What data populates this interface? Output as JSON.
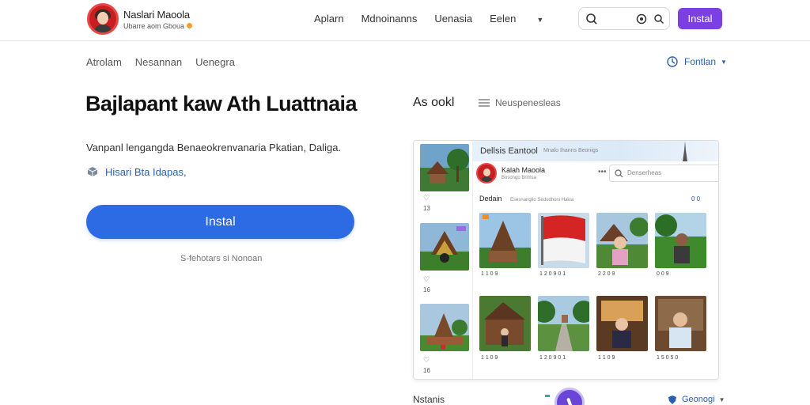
{
  "header": {
    "brand_title": "Naslari Maoola",
    "brand_sub": "Ubarre aom Gboua",
    "nav": [
      "Aplarn",
      "Mdnoinanns",
      "Uenasia",
      "Eelen"
    ],
    "search_placeholder": "",
    "install_label": "Instal",
    "accent": "#7b3fe4"
  },
  "subnav": {
    "items": [
      "Atrolam",
      "Nesannan",
      "Uenegra"
    ],
    "language": "Fontlan"
  },
  "hero": {
    "headline": "Bajlapant kaw Ath Luattnaia",
    "description": "Vanpanl lengangda Benaeokrenvanaria Pkatian, Daliga.",
    "meta": "Hisari Bta Idapas,",
    "install_label": "Instal",
    "install_color": "#2c6be4",
    "note": "S-fehotars si Nonoan"
  },
  "preview": {
    "tab_primary": "As ookl",
    "tab_secondary": "Neuspenesleas",
    "frame_title": "Dellsis Eantool",
    "frame_subtitle": "Mnalo Ihanns Beonigs",
    "profile_name": "Kalah Maoola",
    "profile_desc": "Bosongo Brimsa",
    "menu_icon": "more-horizontal-icon",
    "search_placeholder": "Denserheas",
    "section_title": "Dedain",
    "section_sub": "Esesnanglio Sedudhoni Hakia",
    "count": "0 0",
    "left_thumbs": [
      {
        "icon": "heart-icon",
        "num": "13"
      },
      {
        "icon": "heart-icon",
        "num": "16"
      },
      {
        "icon": "heart-icon",
        "num": "16"
      }
    ],
    "photo_labels": [
      "1 1 0 9",
      "1 2 0 9 0 1",
      "2 2 0 9",
      "0 0 9",
      "1 1 0 9",
      "1 2 0 9 0 1",
      "1 1 0 9",
      "1 5 0 5 0"
    ]
  },
  "bottom": {
    "left_label": "Nstanis",
    "right_label": "Geonogi"
  }
}
